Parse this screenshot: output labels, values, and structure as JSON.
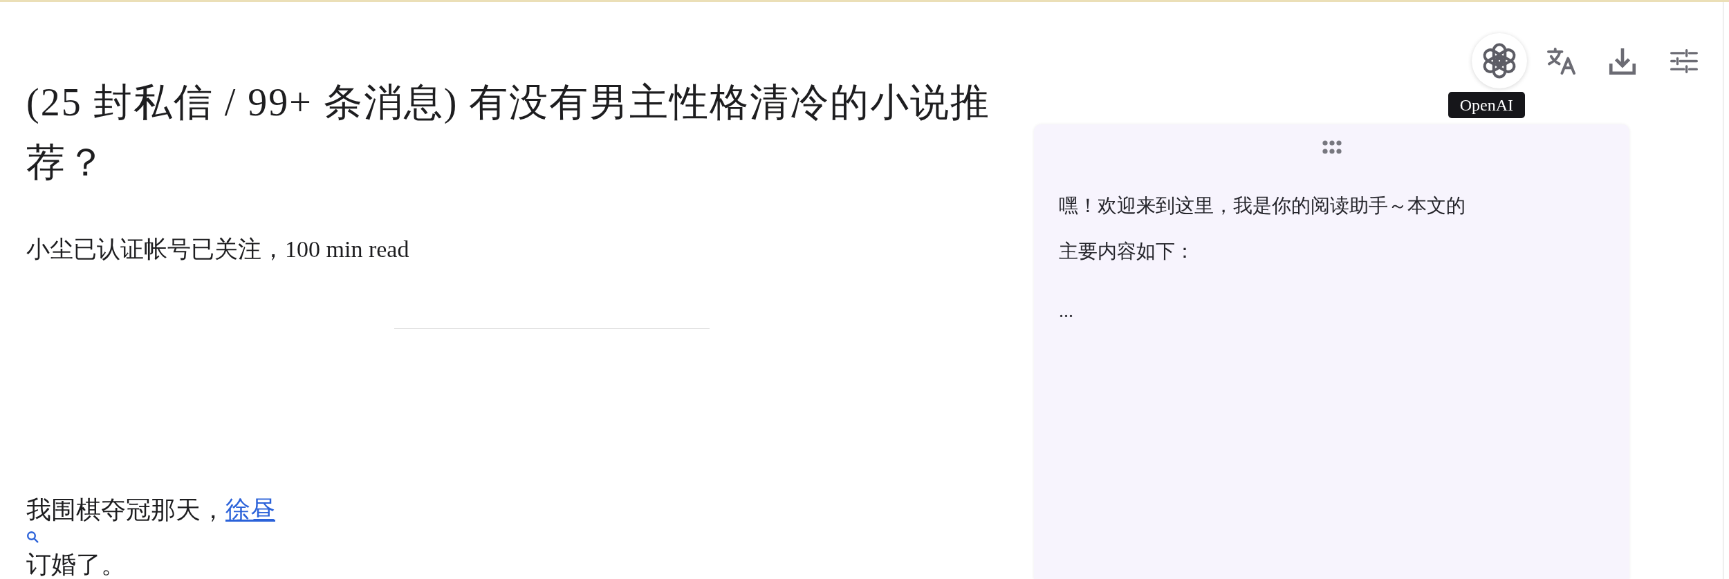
{
  "article": {
    "title": "(25 封私信 / 99+ 条消息) 有没有男主性格清冷的小说推荐？",
    "byline": "小尘已认证帐号已关注，100 min read",
    "paragraph": {
      "text_before_link": "我围棋夺冠那天，",
      "link": "徐昼",
      "text_after": "订婚了。"
    }
  },
  "toolbar": [
    {
      "kind": "openai",
      "hovered": true,
      "tooltip": "OpenAI"
    },
    {
      "kind": "translate",
      "hovered": false
    },
    {
      "kind": "download",
      "hovered": false
    },
    {
      "kind": "settings",
      "hovered": false
    }
  ],
  "assistant_panel": {
    "message": "嘿！欢迎来到这里，我是你的阅读助手～本文的主要内容如下：",
    "ellipsis": "..."
  }
}
